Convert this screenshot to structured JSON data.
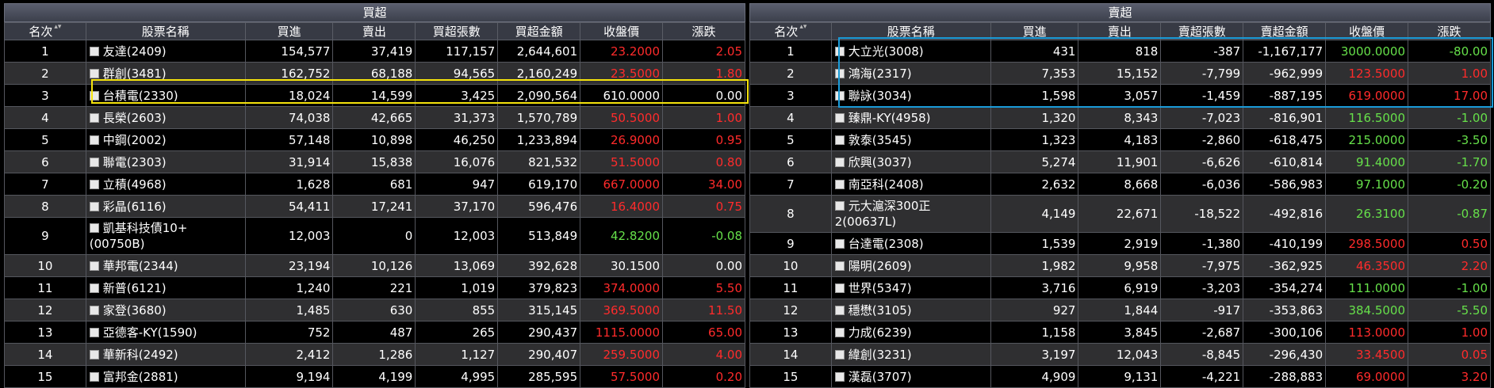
{
  "buy": {
    "title": "買超",
    "headers": [
      "名次",
      "股票名稱",
      "買進",
      "賣出",
      "買超張數",
      "買超金額",
      "收盤價",
      "漲跌"
    ],
    "rows": [
      {
        "rank": "1",
        "name": "友達(2409)",
        "buy": "154,577",
        "sell": "37,419",
        "net": "117,157",
        "amount": "2,644,601",
        "close": "23.2000",
        "chg": "2.05",
        "color": "red"
      },
      {
        "rank": "2",
        "name": "群創(3481)",
        "buy": "162,752",
        "sell": "68,188",
        "net": "94,565",
        "amount": "2,160,249",
        "close": "23.5000",
        "chg": "1.80",
        "color": "red"
      },
      {
        "rank": "3",
        "name": "台積電(2330)",
        "buy": "18,024",
        "sell": "14,599",
        "net": "3,425",
        "amount": "2,090,564",
        "close": "610.0000",
        "chg": "0.00",
        "color": "white"
      },
      {
        "rank": "4",
        "name": "長榮(2603)",
        "buy": "74,038",
        "sell": "42,665",
        "net": "31,373",
        "amount": "1,570,789",
        "close": "50.5000",
        "chg": "1.00",
        "color": "red"
      },
      {
        "rank": "5",
        "name": "中鋼(2002)",
        "buy": "57,148",
        "sell": "10,898",
        "net": "46,250",
        "amount": "1,233,894",
        "close": "26.9000",
        "chg": "0.95",
        "color": "red"
      },
      {
        "rank": "6",
        "name": "聯電(2303)",
        "buy": "31,914",
        "sell": "15,838",
        "net": "16,076",
        "amount": "821,532",
        "close": "51.5000",
        "chg": "0.80",
        "color": "red"
      },
      {
        "rank": "7",
        "name": "立積(4968)",
        "buy": "1,628",
        "sell": "681",
        "net": "947",
        "amount": "619,170",
        "close": "667.0000",
        "chg": "34.00",
        "color": "red"
      },
      {
        "rank": "8",
        "name": "彩晶(6116)",
        "buy": "54,411",
        "sell": "17,241",
        "net": "37,170",
        "amount": "596,476",
        "close": "16.4000",
        "chg": "0.75",
        "color": "red"
      },
      {
        "rank": "9",
        "name": "凱基科技債10+(00750B)",
        "buy": "12,003",
        "sell": "0",
        "net": "12,003",
        "amount": "513,849",
        "close": "42.8200",
        "chg": "-0.08",
        "color": "green"
      },
      {
        "rank": "10",
        "name": "華邦電(2344)",
        "buy": "23,194",
        "sell": "10,126",
        "net": "13,069",
        "amount": "392,628",
        "close": "30.1500",
        "chg": "0.00",
        "color": "white"
      },
      {
        "rank": "11",
        "name": "新普(6121)",
        "buy": "1,240",
        "sell": "221",
        "net": "1,019",
        "amount": "379,823",
        "close": "374.0000",
        "chg": "5.50",
        "color": "red"
      },
      {
        "rank": "12",
        "name": "家登(3680)",
        "buy": "1,485",
        "sell": "630",
        "net": "855",
        "amount": "315,145",
        "close": "369.5000",
        "chg": "11.50",
        "color": "red"
      },
      {
        "rank": "13",
        "name": "亞德客-KY(1590)",
        "buy": "752",
        "sell": "487",
        "net": "265",
        "amount": "290,437",
        "close": "1115.0000",
        "chg": "65.00",
        "color": "red"
      },
      {
        "rank": "14",
        "name": "華新科(2492)",
        "buy": "2,412",
        "sell": "1,286",
        "net": "1,127",
        "amount": "290,407",
        "close": "259.5000",
        "chg": "4.00",
        "color": "red"
      },
      {
        "rank": "15",
        "name": "富邦金(2881)",
        "buy": "9,194",
        "sell": "4,199",
        "net": "4,995",
        "amount": "285,595",
        "close": "57.5000",
        "chg": "0.20",
        "color": "red"
      }
    ]
  },
  "sell": {
    "title": "賣超",
    "headers": [
      "名次",
      "股票名稱",
      "買進",
      "賣出",
      "賣超張數",
      "賣超金額",
      "收盤價",
      "漲跌"
    ],
    "rows": [
      {
        "rank": "1",
        "name": "大立光(3008)",
        "buy": "431",
        "sell": "818",
        "net": "-387",
        "amount": "-1,167,177",
        "close": "3000.0000",
        "chg": "-80.00",
        "color": "green"
      },
      {
        "rank": "2",
        "name": "鴻海(2317)",
        "buy": "7,353",
        "sell": "15,152",
        "net": "-7,799",
        "amount": "-962,999",
        "close": "123.5000",
        "chg": "1.00",
        "color": "red"
      },
      {
        "rank": "3",
        "name": "聯詠(3034)",
        "buy": "1,598",
        "sell": "3,057",
        "net": "-1,459",
        "amount": "-887,195",
        "close": "619.0000",
        "chg": "17.00",
        "color": "red"
      },
      {
        "rank": "4",
        "name": "臻鼎-KY(4958)",
        "buy": "1,320",
        "sell": "8,343",
        "net": "-7,023",
        "amount": "-816,901",
        "close": "116.5000",
        "chg": "-1.00",
        "color": "green"
      },
      {
        "rank": "5",
        "name": "敦泰(3545)",
        "buy": "1,323",
        "sell": "4,183",
        "net": "-2,860",
        "amount": "-618,475",
        "close": "215.0000",
        "chg": "-3.50",
        "color": "green"
      },
      {
        "rank": "6",
        "name": "欣興(3037)",
        "buy": "5,274",
        "sell": "11,901",
        "net": "-6,626",
        "amount": "-610,814",
        "close": "91.4000",
        "chg": "-1.70",
        "color": "green"
      },
      {
        "rank": "7",
        "name": "南亞科(2408)",
        "buy": "2,632",
        "sell": "8,668",
        "net": "-6,036",
        "amount": "-586,983",
        "close": "97.1000",
        "chg": "-0.20",
        "color": "green"
      },
      {
        "rank": "8",
        "name": "元大滬深300正2(00637L)",
        "buy": "4,149",
        "sell": "22,671",
        "net": "-18,522",
        "amount": "-492,816",
        "close": "26.3100",
        "chg": "-0.87",
        "color": "green"
      },
      {
        "rank": "9",
        "name": "台達電(2308)",
        "buy": "1,539",
        "sell": "2,919",
        "net": "-1,380",
        "amount": "-410,199",
        "close": "298.5000",
        "chg": "0.50",
        "color": "red"
      },
      {
        "rank": "10",
        "name": "陽明(2609)",
        "buy": "1,982",
        "sell": "9,958",
        "net": "-7,975",
        "amount": "-362,925",
        "close": "46.3500",
        "chg": "2.20",
        "color": "red"
      },
      {
        "rank": "11",
        "name": "世界(5347)",
        "buy": "3,716",
        "sell": "6,919",
        "net": "-3,203",
        "amount": "-354,274",
        "close": "111.0000",
        "chg": "-1.00",
        "color": "green"
      },
      {
        "rank": "12",
        "name": "穩懋(3105)",
        "buy": "927",
        "sell": "1,844",
        "net": "-917",
        "amount": "-353,863",
        "close": "384.5000",
        "chg": "-5.50",
        "color": "green"
      },
      {
        "rank": "13",
        "name": "力成(6239)",
        "buy": "1,158",
        "sell": "3,845",
        "net": "-2,687",
        "amount": "-300,106",
        "close": "113.0000",
        "chg": "1.00",
        "color": "red"
      },
      {
        "rank": "14",
        "name": "緯創(3231)",
        "buy": "3,197",
        "sell": "12,043",
        "net": "-8,845",
        "amount": "-296,430",
        "close": "33.4500",
        "chg": "0.05",
        "color": "red"
      },
      {
        "rank": "15",
        "name": "漢磊(3707)",
        "buy": "4,909",
        "sell": "9,131",
        "net": "-4,221",
        "amount": "-288,883",
        "close": "69.0000",
        "chg": "3.20",
        "color": "red"
      }
    ]
  },
  "colors": {
    "up": "#ff2b2b",
    "down": "#66e04a",
    "flat": "#ffffff",
    "highlight_yellow": "#f5e30c",
    "highlight_blue": "#1a9bd8"
  },
  "icons": {
    "sort": "sort-arrows-icon",
    "row_checkbox": "checkbox-icon"
  }
}
